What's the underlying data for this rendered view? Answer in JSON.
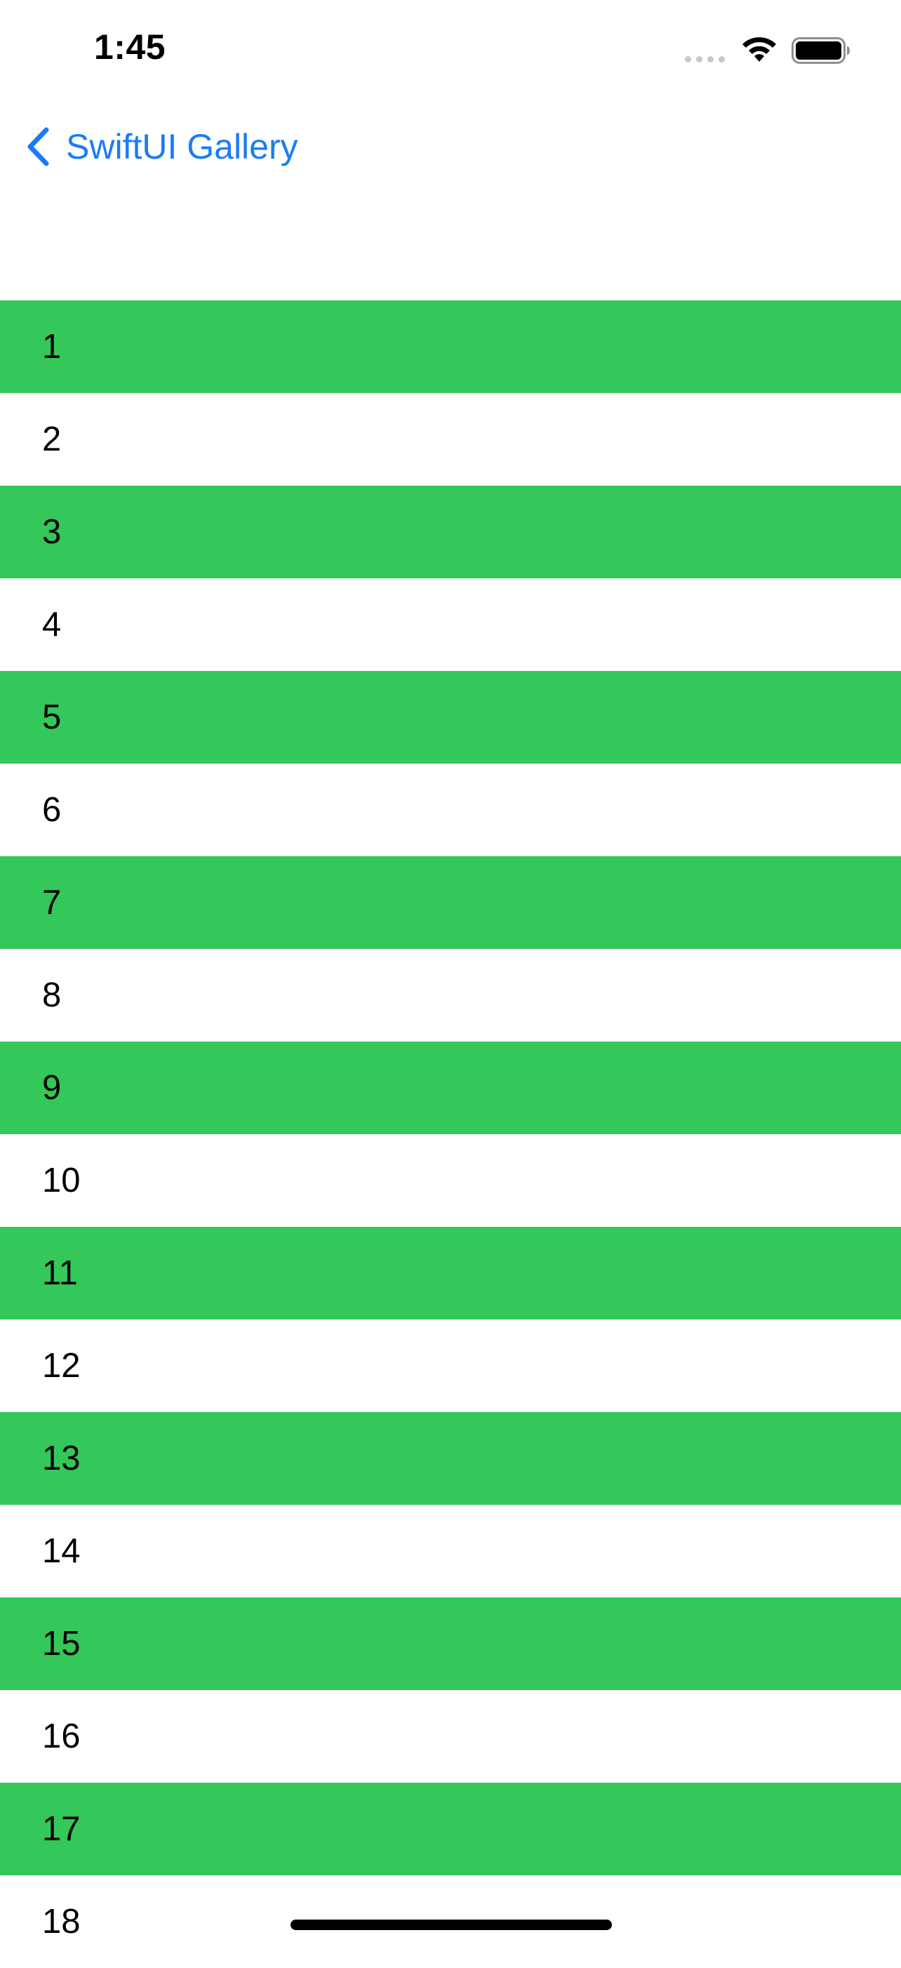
{
  "status_bar": {
    "time": "1:45",
    "icons": [
      "signal-dots-icon",
      "wifi-icon",
      "battery-icon"
    ]
  },
  "nav": {
    "back_label": "SwiftUI Gallery",
    "back_icon": "chevron-left-icon",
    "accent_color": "#1a7cf5"
  },
  "list": {
    "stripe_color": "#34c759",
    "alt_color": "#ffffff",
    "items": [
      "1",
      "2",
      "3",
      "4",
      "5",
      "6",
      "7",
      "8",
      "9",
      "10",
      "11",
      "12",
      "13",
      "14",
      "15",
      "16",
      "17",
      "18"
    ]
  }
}
